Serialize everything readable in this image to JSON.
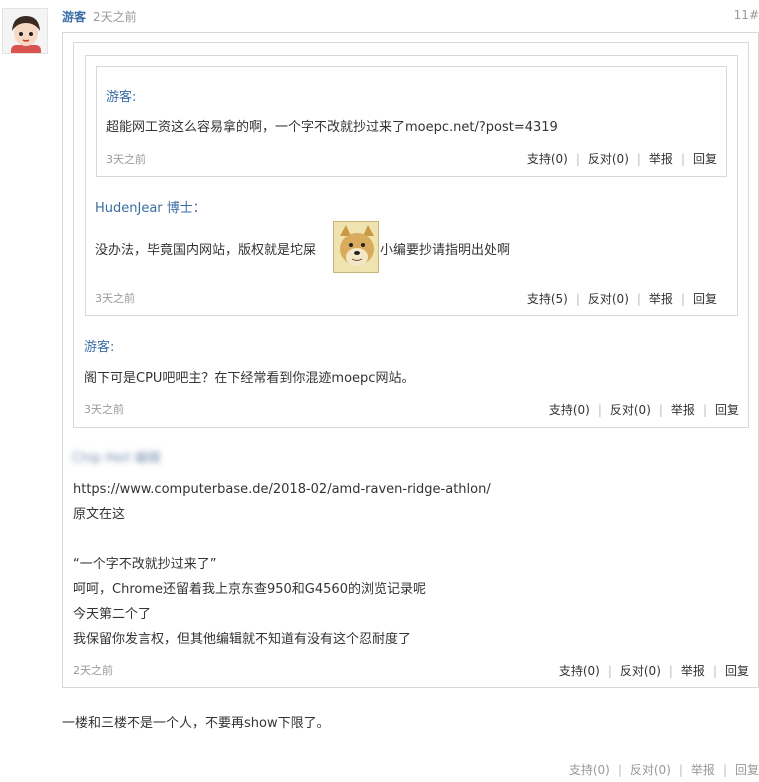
{
  "main_comment": {
    "author": "游客",
    "time": "2天之前",
    "floor": "11#",
    "avatar_icon": "cartoon-girl-avatar-icon"
  },
  "quote_level3": {
    "author": "游客:",
    "text": "超能网工资这么容易拿的啊，一个字不改就抄过来了moepc.net/?post=4319",
    "time": "3天之前",
    "actions": {
      "support": "支持(0)",
      "oppose": "反对(0)",
      "report": "举报",
      "reply": "回复"
    }
  },
  "quote_level2": {
    "author": "HudenJear 博士：",
    "text_before": "没办法，毕竟国内网站，版权就是坨屎",
    "text_after": "小编要抄请指明出处啊",
    "emoji_icon": "doge-emoji-icon",
    "time": "3天之前",
    "actions": {
      "support": "支持(5)",
      "oppose": "反对(0)",
      "report": "举报",
      "reply": "回复"
    }
  },
  "quote_level1": {
    "author": "游客:",
    "text": "阁下可是CPU吧吧主？在下经常看到你混迹moepc网站。",
    "time": "3天之前",
    "actions": {
      "support": "支持(0)",
      "oppose": "反对(0)",
      "report": "举报",
      "reply": "回复"
    }
  },
  "quote_level0": {
    "author": "Chip Hell 编辑",
    "lines": [
      "https://www.computerbase.de/2018-02/amd-raven-ridge-athlon/",
      "原文在这",
      "",
      "“一个字不改就抄过来了”",
      "呵呵，Chrome还留着我上京东查950和G4560的浏览记录呢",
      "今天第二个了",
      "我保留你发言权，但其他编辑就不知道有没有这个忍耐度了"
    ],
    "time": "2天之前",
    "actions": {
      "support": "支持(0)",
      "oppose": "反对(0)",
      "report": "举报",
      "reply": "回复"
    }
  },
  "reply": {
    "text": "一楼和三楼不是一个人，不要再show下限了。",
    "actions": {
      "support": "支持(0)",
      "oppose": "反对(0)",
      "report": "举报",
      "reply": "回复"
    }
  }
}
